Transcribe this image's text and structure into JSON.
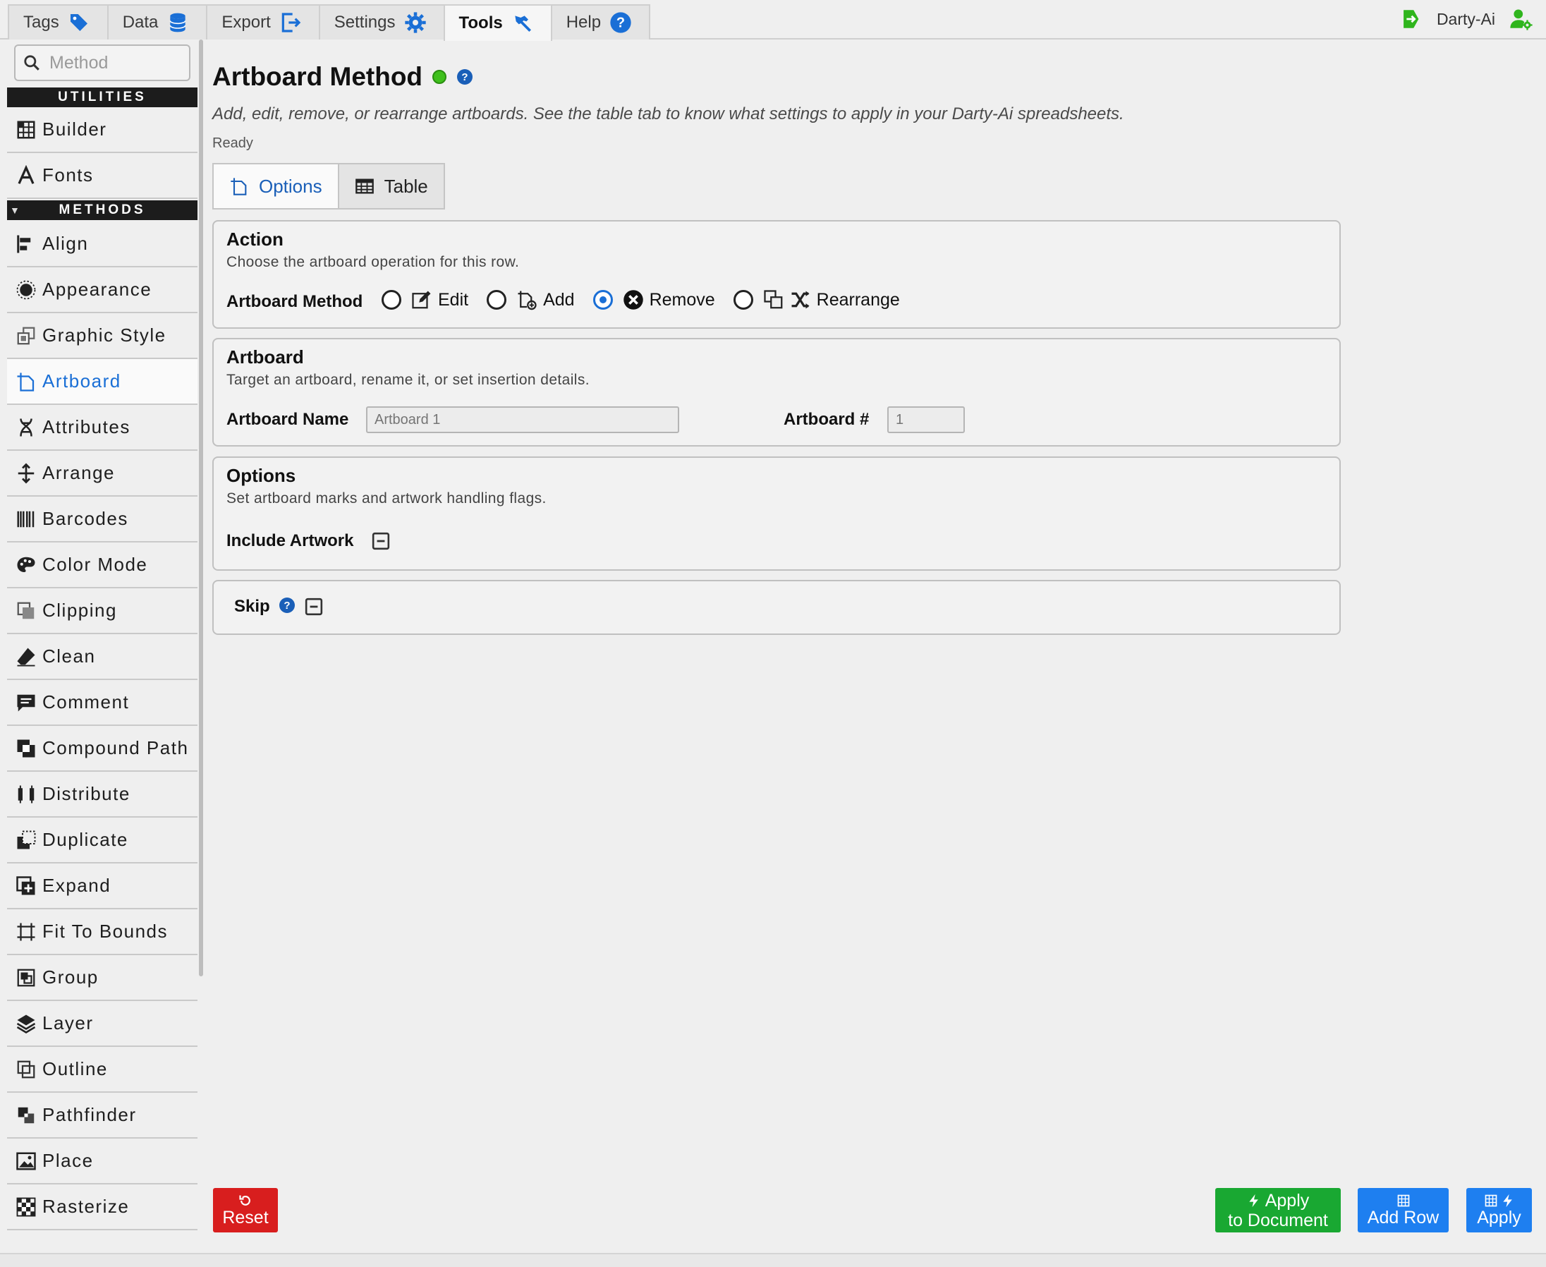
{
  "topbar": {
    "tabs": [
      {
        "label": "Tags",
        "icon": "tag-icon"
      },
      {
        "label": "Data",
        "icon": "database-icon"
      },
      {
        "label": "Export",
        "icon": "export-icon"
      },
      {
        "label": "Settings",
        "icon": "gear-icon"
      },
      {
        "label": "Tools",
        "icon": "hammer-icon",
        "active": true
      },
      {
        "label": "Help",
        "icon": "help-icon"
      }
    ],
    "user_label": "Darty-Ai"
  },
  "sidebar": {
    "search_placeholder": "Method",
    "utilities_header": "UTILITIES",
    "methods_header": "METHODS",
    "utilities": [
      {
        "label": "Builder",
        "icon": "builder-icon"
      },
      {
        "label": "Fonts",
        "icon": "font-icon"
      }
    ],
    "methods": [
      {
        "label": "Align",
        "icon": "align-icon"
      },
      {
        "label": "Appearance",
        "icon": "appearance-icon"
      },
      {
        "label": "Graphic Style",
        "icon": "graphic-style-icon"
      },
      {
        "label": "Artboard",
        "icon": "artboard-icon",
        "active": true
      },
      {
        "label": "Attributes",
        "icon": "attributes-icon"
      },
      {
        "label": "Arrange",
        "icon": "arrange-icon"
      },
      {
        "label": "Barcodes",
        "icon": "barcode-icon"
      },
      {
        "label": "Color Mode",
        "icon": "palette-icon"
      },
      {
        "label": "Clipping",
        "icon": "clipping-icon"
      },
      {
        "label": "Clean",
        "icon": "eraser-icon"
      },
      {
        "label": "Comment",
        "icon": "comment-icon"
      },
      {
        "label": "Compound Path",
        "icon": "compound-path-icon"
      },
      {
        "label": "Distribute",
        "icon": "distribute-icon"
      },
      {
        "label": "Duplicate",
        "icon": "duplicate-icon"
      },
      {
        "label": "Expand",
        "icon": "expand-icon"
      },
      {
        "label": "Fit To Bounds",
        "icon": "fit-bounds-icon"
      },
      {
        "label": "Group",
        "icon": "group-icon"
      },
      {
        "label": "Layer",
        "icon": "layers-icon"
      },
      {
        "label": "Outline",
        "icon": "outline-icon"
      },
      {
        "label": "Pathfinder",
        "icon": "pathfinder-icon"
      },
      {
        "label": "Place",
        "icon": "image-icon"
      },
      {
        "label": "Rasterize",
        "icon": "checker-icon"
      }
    ]
  },
  "main": {
    "title": "Artboard Method",
    "description": "Add, edit, remove, or rearrange artboards. See the table tab to know what settings to apply in your Darty-Ai spreadsheets.",
    "status": "Ready",
    "subtabs": [
      {
        "label": "Options",
        "active": true
      },
      {
        "label": "Table"
      }
    ],
    "action": {
      "title": "Action",
      "subtitle": "Choose the artboard operation for this row.",
      "field_label": "Artboard Method",
      "options": [
        {
          "label": "Edit",
          "checked": false
        },
        {
          "label": "Add",
          "checked": false
        },
        {
          "label": "Remove",
          "checked": true
        },
        {
          "label": "Rearrange",
          "checked": false
        }
      ]
    },
    "artboard": {
      "title": "Artboard",
      "subtitle": "Target an artboard, rename it, or set insertion details.",
      "name_label": "Artboard Name",
      "name_placeholder": "Artboard 1",
      "number_label": "Artboard #",
      "number_placeholder": "1"
    },
    "options": {
      "title": "Options",
      "subtitle": "Set artboard marks and artwork handling flags.",
      "include_label": "Include Artwork"
    },
    "skip": {
      "label": "Skip"
    }
  },
  "buttons": {
    "reset": "Reset",
    "apply_doc_line1": "Apply",
    "apply_doc_line2": "to Document",
    "add_row": "Add Row",
    "apply": "Apply"
  },
  "colors": {
    "accent": "#1a6fd6",
    "status_ok": "#3fc01c",
    "reset": "#d81e1e",
    "apply_doc": "#19a832",
    "apply": "#1e7ff0"
  }
}
